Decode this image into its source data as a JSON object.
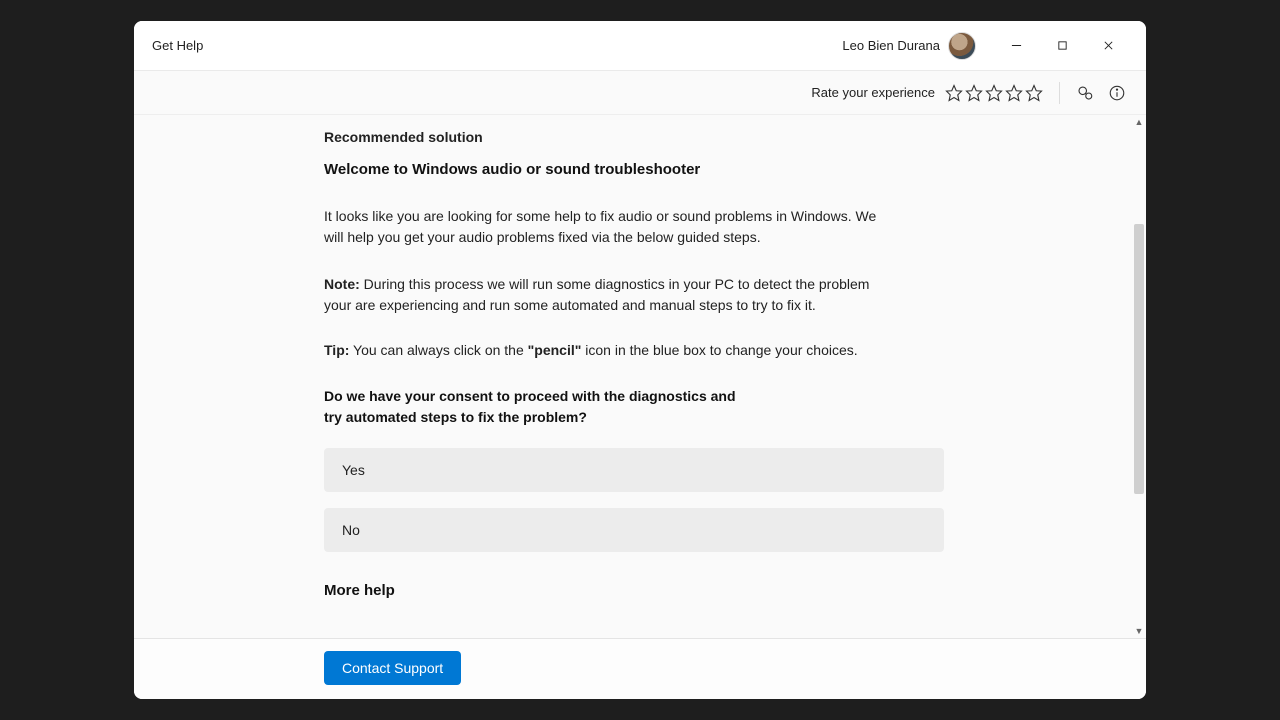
{
  "app_title": "Get Help",
  "user_name": "Leo Bien Durana",
  "rating_label": "Rate your experience",
  "content": {
    "section_label": "Recommended solution",
    "headline": "Welcome to Windows audio or sound troubleshooter",
    "intro": "It looks like you are looking for some help to fix audio or sound problems in Windows. We will help you get your audio problems fixed via the below guided steps.",
    "note_label": "Note:",
    "note_text": " During this process we will run some diagnostics in your PC to detect the problem your are experiencing and run some automated  and manual steps to try to fix it.",
    "tip_label": "Tip:",
    "tip_pre": " You can always click on the ",
    "tip_bold": "\"pencil\"",
    "tip_post": " icon in the blue box to change your choices.",
    "consent_q": "Do we have your consent to proceed with the diagnostics and try automated steps to fix the problem?",
    "options": {
      "yes": "Yes",
      "no": "No"
    },
    "more_help": "More help"
  },
  "footer": {
    "contact_support": "Contact Support"
  }
}
